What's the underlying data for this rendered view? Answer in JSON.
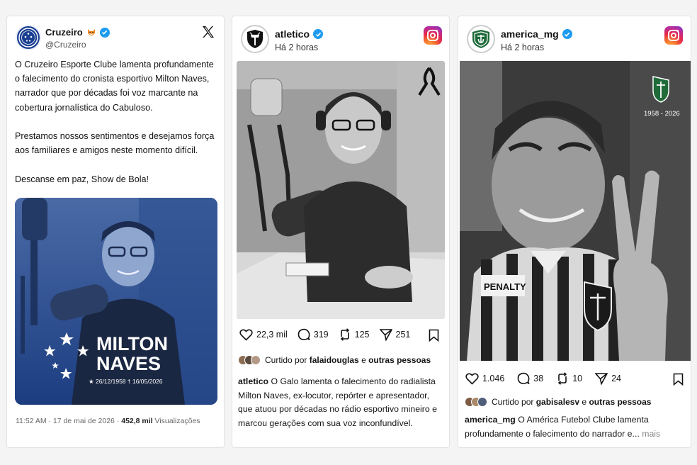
{
  "twitter": {
    "name": "Cruzeiro",
    "handle": "@Cruzeiro",
    "paragraphs": [
      "O Cruzeiro Esporte Clube lamenta profundamente o falecimento do cronista esportivo Milton Naves, narrador que por décadas foi voz marcante na cobertura jornalística do Cabuloso.",
      "Prestamos nossos sentimentos e desejamos força aos familiares e amigos neste momento difícil.",
      "Descanse em paz, Show de Bola!"
    ],
    "media": {
      "name_line1": "MILTON",
      "name_line2": "NAVES",
      "dates": "★ 26/12/1958   † 16/05/2026"
    },
    "timestamp": "11:52 AM · 17 de mai de 2026 · ",
    "views_count": "452,8 mil",
    "views_label": " Visualizações"
  },
  "atletico": {
    "username": "atletico",
    "time": "Há 2 horas",
    "likes": "22,3 mil",
    "comments": "319",
    "reposts": "125",
    "shares": "251",
    "liked_prefix": "Curtido por ",
    "liked_user": "falaidouglas",
    "liked_mid": " e ",
    "liked_suffix": "outras pessoas",
    "caption_user": "atletico",
    "caption_text": " O Galo lamenta o falecimento do radialista Milton Naves, ex-locutor, repórter e apresentador, que atuou por décadas no rádio esportivo mineiro e marcou gerações com sua voz inconfundível."
  },
  "america": {
    "username": "america_mg",
    "time": "Há 2 horas",
    "years": "1958 - 2026",
    "shirt_text": "PENALTY",
    "likes": "1.046",
    "comments": "38",
    "reposts": "10",
    "shares": "24",
    "liked_prefix": "Curtido por ",
    "liked_user": "gabisalesv",
    "liked_mid": " e ",
    "liked_suffix": "outras pessoas",
    "caption_user": "america_mg",
    "caption_text": " O América Futebol Clube lamenta profundamente o falecimento do narrador e...",
    "caption_more": " mais"
  },
  "colors": {
    "cruzeiro_blue": "#1a3e91",
    "verified_blue": "#1d9bf0",
    "america_green": "#1f6b3a"
  }
}
